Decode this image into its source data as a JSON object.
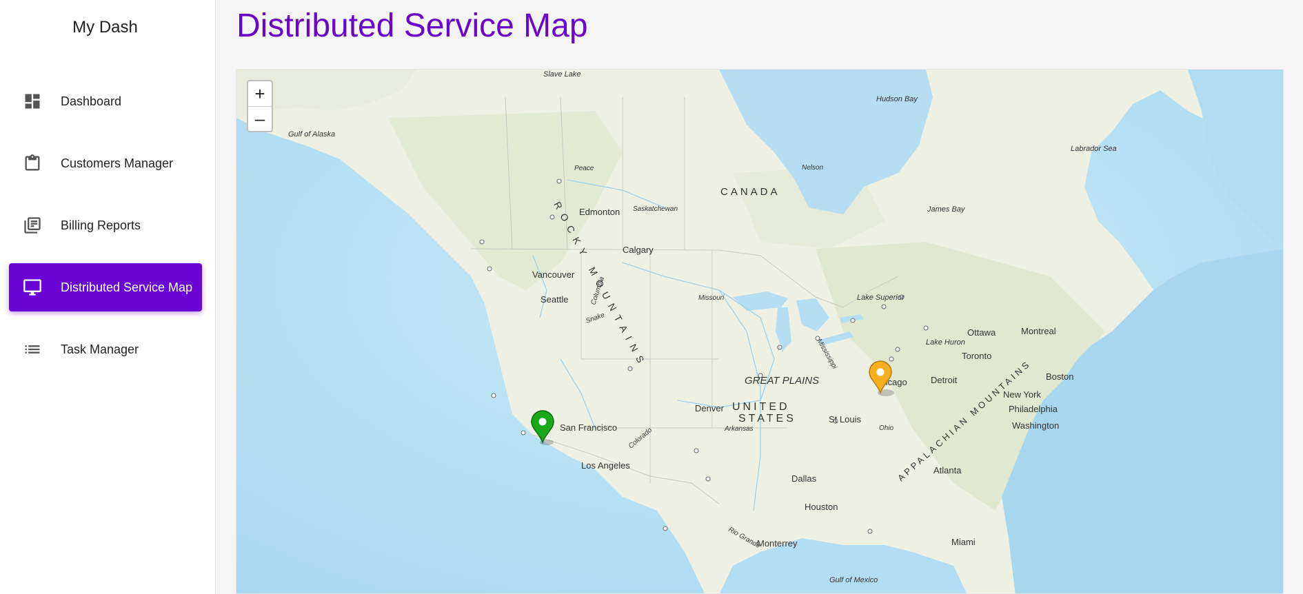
{
  "app": {
    "brand": "My Dash"
  },
  "sidebar": {
    "items": [
      {
        "label": "Dashboard",
        "icon": "dashboard-icon",
        "active": false
      },
      {
        "label": "Customers Manager",
        "icon": "clipboard-icon",
        "active": false
      },
      {
        "label": "Billing Reports",
        "icon": "library-books-icon",
        "active": false
      },
      {
        "label": "Distributed Service Map",
        "icon": "monitor-icon",
        "active": true
      },
      {
        "label": "Task Manager",
        "icon": "list-icon",
        "active": false
      }
    ]
  },
  "page": {
    "title": "Distributed Service Map"
  },
  "map": {
    "zoom_in": "+",
    "zoom_out": "–",
    "labels": {
      "slave_lake": "Slave Lake",
      "gulf_of_alaska": "Gulf of Alaska",
      "hudson_bay": "Hudson Bay",
      "labrador_sea": "Labrador Sea",
      "canada": "CANADA",
      "nelson": "Nelson",
      "peace": "Peace",
      "edmonton": "Edmonton",
      "saskatchewan": "Saskatchewan",
      "james_bay": "James Bay",
      "calgary": "Calgary",
      "rocky_mountains": "ROCKY MOUNTAINS",
      "vancouver": "Vancouver",
      "seattle": "Seattle",
      "missouri": "Missouri",
      "lake_superior": "Lake Superior",
      "mississippi": "Mississippi",
      "ottawa": "Ottawa",
      "montreal": "Montreal",
      "lake_huron": "Lake Huron",
      "toronto": "Toronto",
      "great_plains": "GREAT PLAINS",
      "chicago": "Chicago",
      "detroit": "Detroit",
      "boston": "Boston",
      "new_york": "New York",
      "philadelphia": "Philadelphia",
      "washington": "Washington",
      "appalachian_mountains": "APPALACHIAN MOUNTAINS",
      "denver": "Denver",
      "united": "UNITED",
      "states": "STATES",
      "st_louis": "St Louis",
      "arkansas": "Arkansas",
      "ohio": "Ohio",
      "san_francisco": "San Francisco",
      "colorado": "Colorado",
      "snake": "Snake",
      "columbia": "Columbia",
      "los_angeles": "Los Angeles",
      "atlanta": "Atlanta",
      "dallas": "Dallas",
      "rio_grande": "Rio Grande",
      "houston": "Houston",
      "monterrey": "Monterrey",
      "miami": "Miami",
      "gulf_of_mexico": "Gulf of Mexico"
    },
    "markers": [
      {
        "name": "san-francisco-marker",
        "color": "#18a818"
      },
      {
        "name": "chicago-marker",
        "color": "#f5b021"
      }
    ]
  },
  "colors": {
    "accent": "#6a06d4",
    "title": "#6a06c8",
    "water": "#b4def2",
    "land": "#eef0e6"
  }
}
